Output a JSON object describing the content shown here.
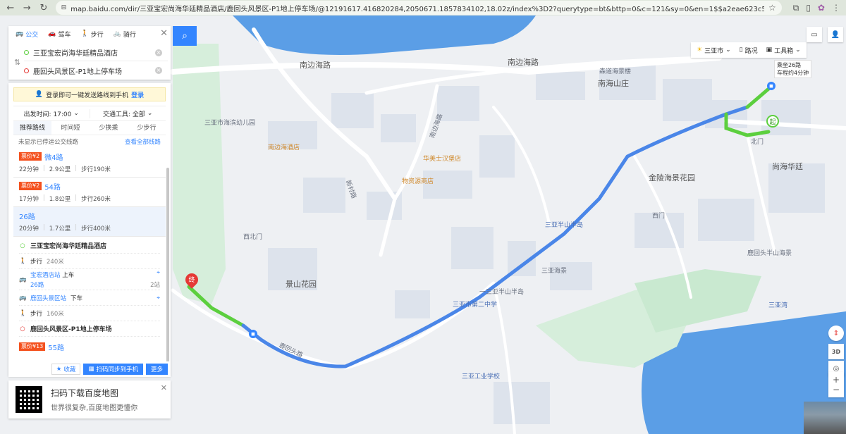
{
  "browser": {
    "url": "map.baidu.com/dir/三亚宝宏尚海华廷精品酒店/鹿回头风景区-P1地上停车场/@12191617.416820284,2050671.1857834102,18.02z/index%3D2?querytype=bt&bttp=0&c=121&sy=0&en=1$$a2eae623c5d4d25cca1b9516$$12191088.29,2050598.1..."
  },
  "search": {
    "modes": [
      "公交",
      "驾车",
      "步行",
      "骑行"
    ],
    "active_mode": "公交",
    "origin": "三亚宝宏尚海华廷精品酒店",
    "destination": "鹿回头风景区-P1地上停车场"
  },
  "results": {
    "login_tip": "登录即可一键发送路线到手机",
    "login_link": "登录",
    "depart_label": "出发时间: 17:00",
    "transport_label": "交通工具: 全部",
    "sort_tabs": [
      "推荐路线",
      "时间短",
      "少换乘",
      "少步行"
    ],
    "active_sort": "推荐路线",
    "notice": "未显示已停运公交线路",
    "view_all": "查看全部线路",
    "routes": [
      {
        "price": "票价¥2",
        "name": "微4路",
        "time": "22分钟",
        "distance": "2.9公里",
        "walk": "步行190米"
      },
      {
        "price": "票价¥2",
        "name": "54路",
        "time": "17分钟",
        "distance": "1.8公里",
        "walk": "步行260米"
      },
      {
        "price": "",
        "name": "26路",
        "time": "20分钟",
        "distance": "1.7公里",
        "walk": "步行400米"
      },
      {
        "price": "票价¥13",
        "name": "55路"
      }
    ],
    "steps": {
      "origin": "三亚宝宏尚海华廷精品酒店",
      "walk1_label": "步行",
      "walk1_dist": "240米",
      "board_station": "宝宏酒店站",
      "board_action": "上车",
      "line": "26路",
      "stops": "2站",
      "alight_station": "鹿回头景区站",
      "alight_action": "下车",
      "walk2_label": "步行",
      "walk2_dist": "160米",
      "destination": "鹿回头风景区-P1地上停车场"
    },
    "favorite": "收藏",
    "scan_send": "扫码同步到手机",
    "more": "更多"
  },
  "download": {
    "title": "扫码下载百度地图",
    "subtitle": "世界很复杂,百度地图更懂你"
  },
  "map_tools": {
    "city": "三亚市",
    "traffic": "路况",
    "toolbox": "工具箱",
    "three_d": "3D",
    "callout_line1": "乘坐26路",
    "callout_line2": "车程约4分钟",
    "start_marker": "起",
    "end_marker": "终"
  },
  "map_labels": [
    {
      "t": "南边海路",
      "c": "big"
    },
    {
      "t": "南边海路",
      "c": "big"
    },
    {
      "t": "南海山庄",
      "c": "big"
    },
    {
      "t": "尚海华廷",
      "c": "big"
    },
    {
      "t": "金陵海景花园",
      "c": "big"
    },
    {
      "t": "景山花园",
      "c": "big"
    },
    {
      "t": "鹿回头路",
      "c": "big"
    },
    {
      "t": "新村路",
      "c": ""
    },
    {
      "t": "南边海路",
      "c": ""
    },
    {
      "t": "南边海酒店",
      "c": "orange"
    },
    {
      "t": "华美士汉堡店",
      "c": "orange"
    },
    {
      "t": "物资源商店",
      "c": "orange"
    },
    {
      "t": "三亚市第二中学",
      "c": "blue"
    },
    {
      "t": "三亚工业学校",
      "c": "blue"
    },
    {
      "t": "三亚半山半岛",
      "c": "blue"
    },
    {
      "t": "三亚海景",
      "c": ""
    },
    {
      "t": "森道海景楼",
      "c": ""
    },
    {
      "t": "三亚湾",
      "c": "blue"
    },
    {
      "t": "鹿回头半山海景",
      "c": ""
    },
    {
      "t": "西北门",
      "c": ""
    },
    {
      "t": "西门",
      "c": ""
    },
    {
      "t": "北门",
      "c": ""
    },
    {
      "t": "三亚市海滨幼儿园",
      "c": ""
    },
    {
      "t": "一三亚半山半岛",
      "c": ""
    }
  ],
  "colors": {
    "route_bus": "#4a86e8",
    "route_walk": "#5ccf3e",
    "accent": "#3385ff",
    "price": "#f4511e",
    "sea": "#5b9ee6"
  }
}
